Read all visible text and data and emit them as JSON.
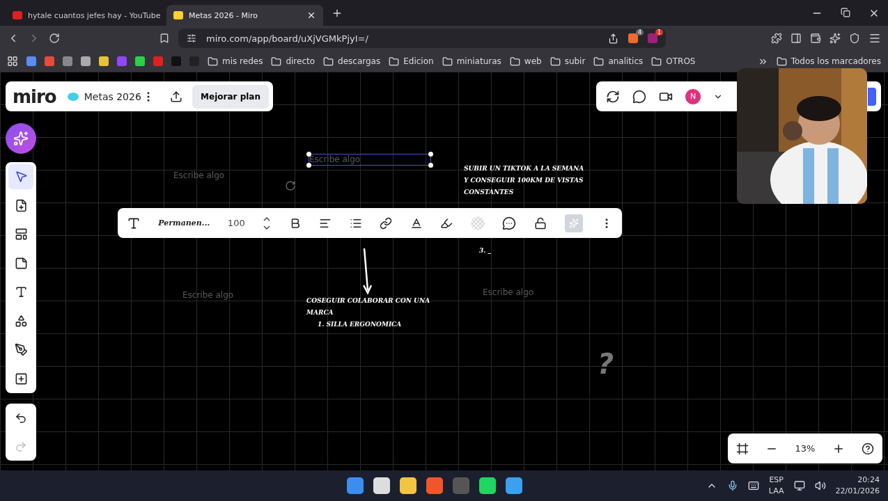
{
  "browser": {
    "tabs": [
      {
        "title": "hytale cuantos jefes hay - YouTube",
        "kind": "youtube",
        "selected": false
      },
      {
        "title": "Metas 2026 - Miro",
        "kind": "miro",
        "selected": true
      }
    ],
    "url": "miro.com/app/board/uXjVGMkPjyI=/",
    "extension_badges": [
      "4",
      "1"
    ],
    "bookmark_folders": [
      "mis redes",
      "directo",
      "descargas",
      "Edicion",
      "miniaturas",
      "web",
      "subir",
      "analitics",
      "OTROS"
    ],
    "all_bookmarks": "Todos los marcadores"
  },
  "board": {
    "logo": "miro",
    "title": "Metas 2026",
    "upgrade_button": "Mejorar plan",
    "avatar": "N",
    "tools": [
      {
        "kind": "select",
        "selected": true
      },
      {
        "kind": "note-add",
        "selected": false
      },
      {
        "kind": "template",
        "selected": false
      },
      {
        "kind": "sticky",
        "selected": false
      },
      {
        "kind": "text",
        "selected": false
      },
      {
        "kind": "shapes",
        "selected": false
      },
      {
        "kind": "pen",
        "selected": false
      },
      {
        "kind": "more",
        "selected": false
      }
    ],
    "format_toolbar": {
      "font": "Permanen...",
      "size": "100"
    },
    "items": [
      {
        "kind": "placeholder",
        "text": "Escribe algo",
        "selected": false
      },
      {
        "kind": "placeholder",
        "text": "Escribe algo",
        "selected": true
      },
      {
        "kind": "note",
        "text": "SUBIR UN TIKTOK A LA SEMANA Y CONSEGUIR 100KM DE VISTAS CONSTANTES"
      },
      {
        "kind": "note",
        "text": "3. _"
      },
      {
        "kind": "note",
        "text": "COSEGUIR COLABORAR CON UNA MARCA",
        "sub": "1. SILLA ERGONOMICA"
      },
      {
        "kind": "placeholder",
        "text": "Escribe algo",
        "selected": false
      },
      {
        "kind": "placeholder",
        "text": "Escribe algo",
        "selected": false
      },
      {
        "kind": "mark",
        "text": "?"
      }
    ],
    "zoom": "13%"
  },
  "taskbar": {
    "language": "ESP",
    "layout": "LAA",
    "time": "20:24",
    "date": "22/01/2026"
  }
}
